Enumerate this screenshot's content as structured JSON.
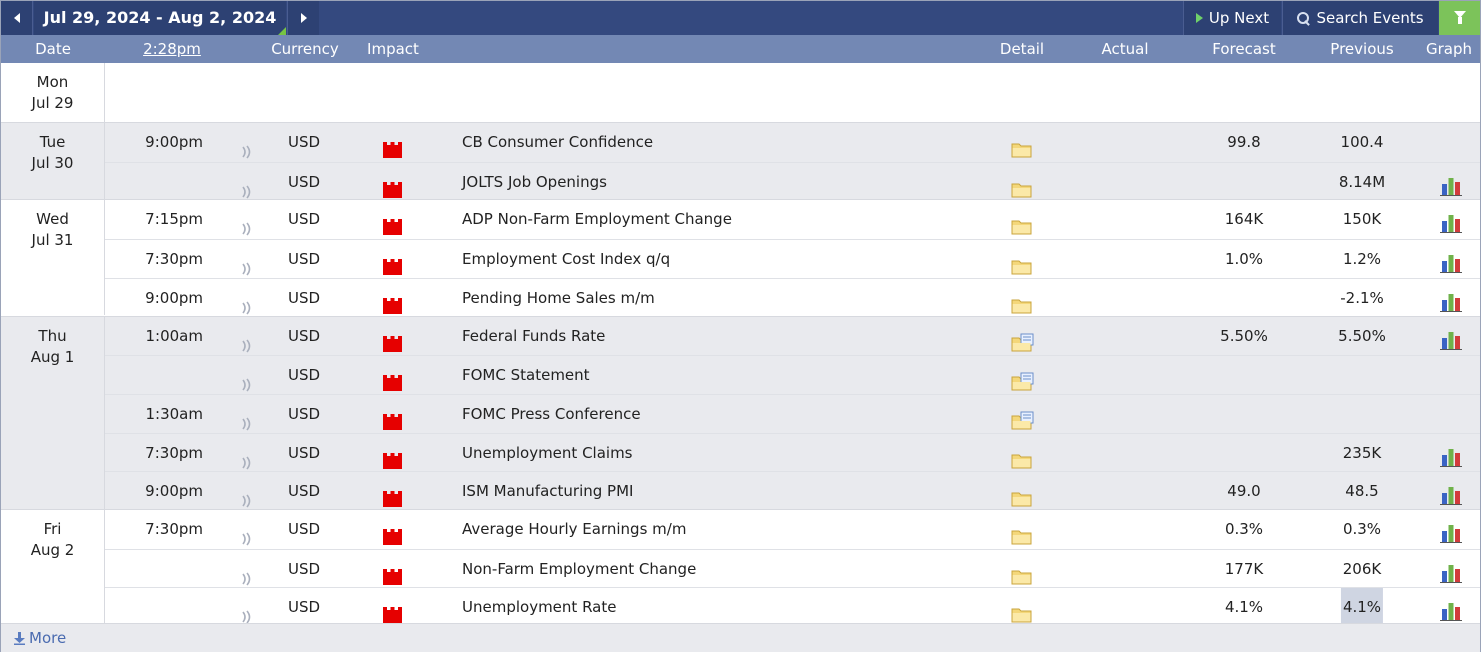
{
  "nav": {
    "range_label": "Jul 29, 2024 - Aug 2, 2024",
    "up_next_label": "Up Next",
    "search_label": "Search Events"
  },
  "header": {
    "date": "Date",
    "time": "2:28pm",
    "currency": "Currency",
    "impact": "Impact",
    "detail": "Detail",
    "actual": "Actual",
    "forecast": "Forecast",
    "previous": "Previous",
    "graph": "Graph"
  },
  "colors": {
    "topbar": "#34497f",
    "header": "#7388b4",
    "filter": "#7cc35a",
    "impact_high": "#e60000",
    "row_alt": "#e9eaee"
  },
  "days": [
    {
      "weekday": "Mon",
      "date": "Jul 29",
      "rows": []
    },
    {
      "weekday": "Tue",
      "date": "Jul 30",
      "rows": [
        {
          "time": "9:00pm",
          "currency": "USD",
          "event": "CB Consumer Confidence",
          "detail": "folder-icon",
          "forecast": "99.8",
          "previous": "100.4",
          "graph": false
        },
        {
          "time": "",
          "currency": "USD",
          "event": "JOLTS Job Openings",
          "detail": "folder-icon",
          "forecast": "",
          "previous": "8.14M",
          "graph": true
        }
      ]
    },
    {
      "weekday": "Wed",
      "date": "Jul 31",
      "rows": [
        {
          "time": "7:15pm",
          "currency": "USD",
          "event": "ADP Non-Farm Employment Change",
          "detail": "folder-icon",
          "forecast": "164K",
          "previous": "150K",
          "graph": true
        },
        {
          "time": "7:30pm",
          "currency": "USD",
          "event": "Employment Cost Index q/q",
          "detail": "folder-icon",
          "forecast": "1.0%",
          "previous": "1.2%",
          "graph": true
        },
        {
          "time": "9:00pm",
          "currency": "USD",
          "event": "Pending Home Sales m/m",
          "detail": "folder-icon",
          "forecast": "",
          "previous": "-2.1%",
          "graph": true
        }
      ]
    },
    {
      "weekday": "Thu",
      "date": "Aug 1",
      "rows": [
        {
          "time": "1:00am",
          "currency": "USD",
          "event": "Federal Funds Rate",
          "detail": "folder-doc-icon",
          "forecast": "5.50%",
          "previous": "5.50%",
          "graph": true
        },
        {
          "time": "",
          "currency": "USD",
          "event": "FOMC Statement",
          "detail": "folder-doc-icon",
          "forecast": "",
          "previous": "",
          "graph": false
        },
        {
          "time": "1:30am",
          "currency": "USD",
          "event": "FOMC Press Conference",
          "detail": "folder-doc-icon",
          "forecast": "",
          "previous": "",
          "graph": false
        },
        {
          "time": "7:30pm",
          "currency": "USD",
          "event": "Unemployment Claims",
          "detail": "folder-icon",
          "forecast": "",
          "previous": "235K",
          "graph": true
        },
        {
          "time": "9:00pm",
          "currency": "USD",
          "event": "ISM Manufacturing PMI",
          "detail": "folder-icon",
          "forecast": "49.0",
          "previous": "48.5",
          "graph": true
        }
      ]
    },
    {
      "weekday": "Fri",
      "date": "Aug 2",
      "rows": [
        {
          "time": "7:30pm",
          "currency": "USD",
          "event": "Average Hourly Earnings m/m",
          "detail": "folder-icon",
          "forecast": "0.3%",
          "previous": "0.3%",
          "graph": true
        },
        {
          "time": "",
          "currency": "USD",
          "event": "Non-Farm Employment Change",
          "detail": "folder-icon",
          "forecast": "177K",
          "previous": "206K",
          "graph": true
        },
        {
          "time": "",
          "currency": "USD",
          "event": "Unemployment Rate",
          "detail": "folder-icon",
          "forecast": "4.1%",
          "previous": "4.1%",
          "graph": true,
          "previous_highlighted": true
        }
      ]
    }
  ],
  "more_label": "More"
}
